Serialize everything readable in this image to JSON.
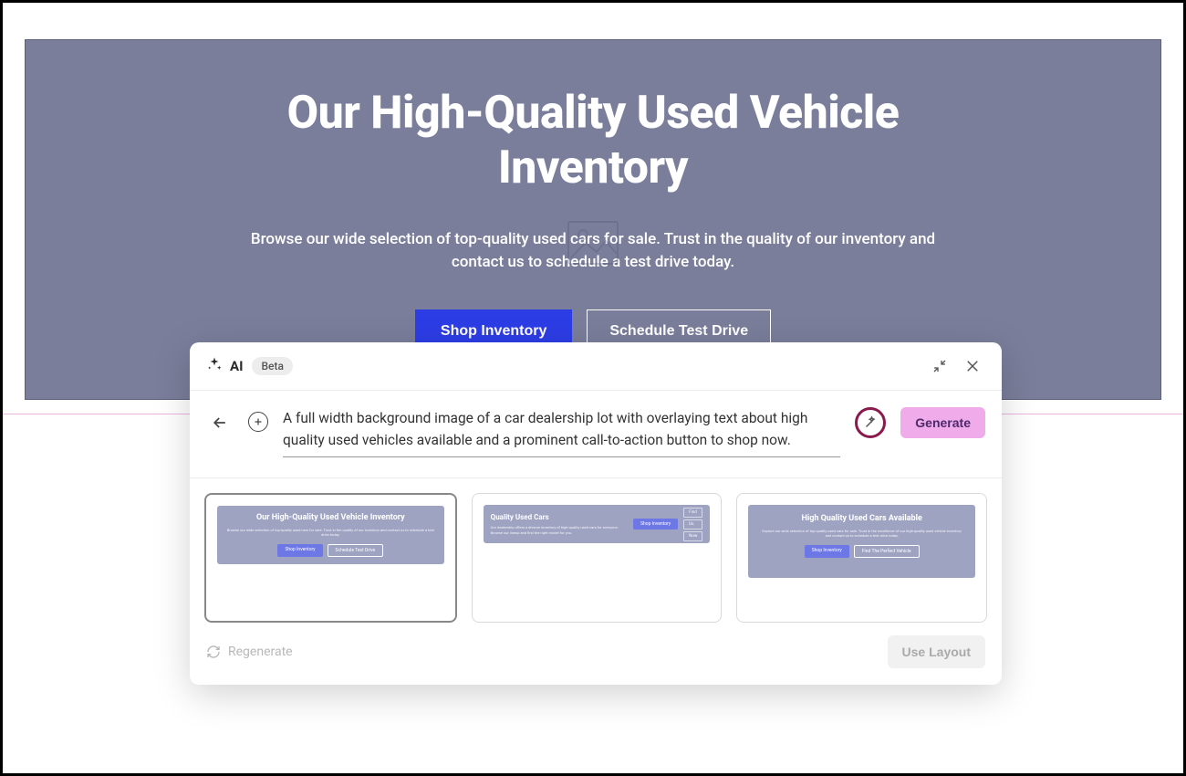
{
  "hero": {
    "title": "Our High-Quality Used Vehicle Inventory",
    "subtitle": "Browse our wide selection of top-quality used cars for sale. Trust in the quality of our inventory and contact us to schedule a test drive today.",
    "primary_cta": "Shop Inventory",
    "secondary_cta": "Schedule Test Drive"
  },
  "ai_modal": {
    "label": "AI",
    "badge": "Beta",
    "prompt": "A full width background image of a car dealership lot with overlaying text about high quality used vehicles available and a prominent call-to-action button to shop now.",
    "generate": "Generate",
    "regenerate": "Regenerate",
    "use_layout": "Use Layout",
    "layouts": [
      {
        "title": "Our High-Quality Used Vehicle Inventory",
        "sub": "Browse our wide selection of top-quality used cars for sale. Trust in the quality of our inventory and contact us to schedule a test drive today.",
        "btn1": "Shop Inventory",
        "btn2": "Schedule Test Drive"
      },
      {
        "title": "Quality Used Cars",
        "sub": "Our dealership offers a diverse inventory of high-quality used cars for everyone. Browse our lineup and find the right model for you.",
        "btn1": "Shop Inventory",
        "stack1": "Find",
        "stack2": "Us",
        "stack3": "Now"
      },
      {
        "title": "High Quality Used Cars Available",
        "sub": "Explore our wide selection of top-quality used cars for sale. Trust in the excellence of our high-quality used vehicle inventory and contact us to schedule a test drive today.",
        "btn1": "Shop Inventory",
        "btn2": "Find The Perfect Vehicle"
      }
    ]
  }
}
